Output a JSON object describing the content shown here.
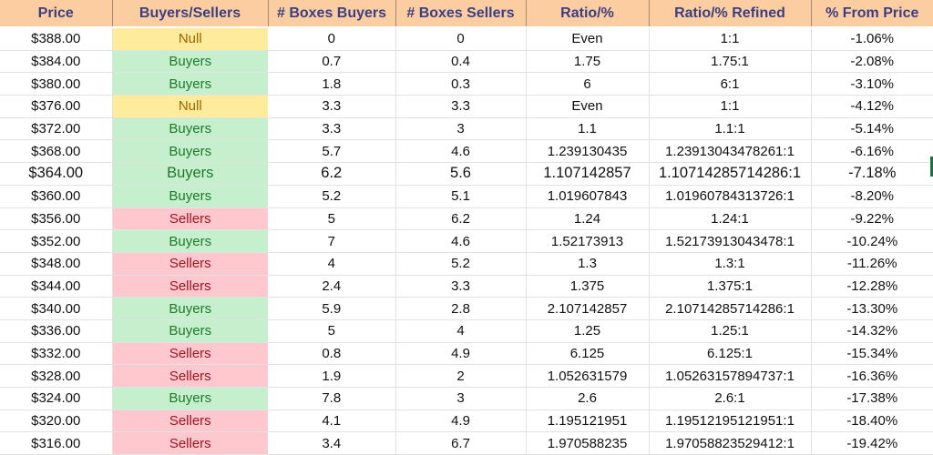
{
  "table": {
    "headers": [
      "Price",
      "Buyers/Sellers",
      "# Boxes Buyers",
      "# Boxes Sellers",
      "Ratio/%",
      "Ratio/% Refined",
      "% From Price"
    ],
    "status_colors": {
      "Buyers": {
        "bg": "#c6efce",
        "fg": "#1e7a2a"
      },
      "Sellers": {
        "bg": "#ffc7ce",
        "fg": "#a1141e"
      },
      "Null": {
        "bg": "#ffeb9c",
        "fg": "#9c6500"
      }
    },
    "header_bg": "#fccda0",
    "header_fg": "#3b3f82",
    "rows": [
      [
        "$388.00",
        "Null",
        "0",
        "0",
        "Even",
        "1:1",
        "-1.06%"
      ],
      [
        "$384.00",
        "Buyers",
        "0.7",
        "0.4",
        "1.75",
        "1.75:1",
        "-2.08%"
      ],
      [
        "$380.00",
        "Buyers",
        "1.8",
        "0.3",
        "6",
        "6:1",
        "-3.10%"
      ],
      [
        "$376.00",
        "Null",
        "3.3",
        "3.3",
        "Even",
        "1:1",
        "-4.12%"
      ],
      [
        "$372.00",
        "Buyers",
        "3.3",
        "3",
        "1.1",
        "1.1:1",
        "-5.14%"
      ],
      [
        "$368.00",
        "Buyers",
        "5.7",
        "4.6",
        "1.239130435",
        "1.23913043478261:1",
        "-6.16%"
      ],
      [
        "$364.00",
        "Buyers",
        "6.2",
        "5.6",
        "1.107142857",
        "1.10714285714286:1",
        "-7.18%"
      ],
      [
        "$360.00",
        "Buyers",
        "5.2",
        "5.1",
        "1.019607843",
        "1.01960784313726:1",
        "-8.20%"
      ],
      [
        "$356.00",
        "Sellers",
        "5",
        "6.2",
        "1.24",
        "1.24:1",
        "-9.22%"
      ],
      [
        "$352.00",
        "Buyers",
        "7",
        "4.6",
        "1.52173913",
        "1.52173913043478:1",
        "-10.24%"
      ],
      [
        "$348.00",
        "Sellers",
        "4",
        "5.2",
        "1.3",
        "1.3:1",
        "-11.26%"
      ],
      [
        "$344.00",
        "Sellers",
        "2.4",
        "3.3",
        "1.375",
        "1.375:1",
        "-12.28%"
      ],
      [
        "$340.00",
        "Buyers",
        "5.9",
        "2.8",
        "2.107142857",
        "2.10714285714286:1",
        "-13.30%"
      ],
      [
        "$336.00",
        "Buyers",
        "5",
        "4",
        "1.25",
        "1.25:1",
        "-14.32%"
      ],
      [
        "$332.00",
        "Sellers",
        "0.8",
        "4.9",
        "6.125",
        "6.125:1",
        "-15.34%"
      ],
      [
        "$328.00",
        "Sellers",
        "1.9",
        "2",
        "1.052631579",
        "1.05263157894737:1",
        "-16.36%"
      ],
      [
        "$324.00",
        "Buyers",
        "7.8",
        "3",
        "2.6",
        "2.6:1",
        "-17.38%"
      ],
      [
        "$320.00",
        "Sellers",
        "4.1",
        "4.9",
        "1.195121951",
        "1.19512195121951:1",
        "-18.40%"
      ],
      [
        "$316.00",
        "Sellers",
        "3.4",
        "6.7",
        "1.970588235",
        "1.97058823529412:1",
        "-19.42%"
      ]
    ],
    "emphasized_row": 6
  }
}
